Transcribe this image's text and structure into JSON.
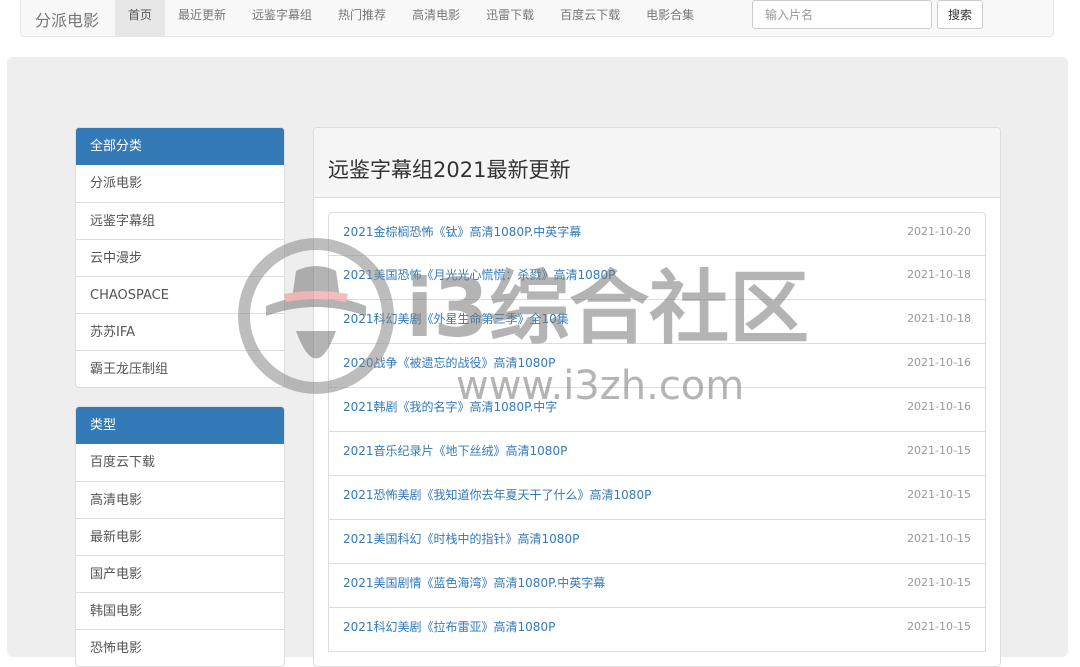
{
  "brand": "分派电影",
  "nav": [
    {
      "label": "首页",
      "active": true
    },
    {
      "label": "最近更新"
    },
    {
      "label": "远鉴字幕组"
    },
    {
      "label": "热门推荐"
    },
    {
      "label": "高清电影"
    },
    {
      "label": "迅雷下载"
    },
    {
      "label": "百度云下载"
    },
    {
      "label": "电影合集"
    }
  ],
  "search": {
    "placeholder": "输入片名",
    "button": "搜索"
  },
  "categories": {
    "heading": "全部分类",
    "items": [
      "分派电影",
      "远鉴字幕组",
      "云中漫步",
      "CHAOSPACE",
      "苏苏IFA",
      "霸王龙压制组"
    ]
  },
  "types": {
    "heading": "类型",
    "items": [
      "百度云下载",
      "高清电影",
      "最新电影",
      "国产电影",
      "韩国电影",
      "恐怖电影"
    ]
  },
  "main": {
    "title": "远鉴字幕组2021最新更新",
    "items": [
      {
        "title": "2021金棕榈恐怖《钛》高清1080P.中英字幕",
        "date": "2021-10-20"
      },
      {
        "title": "2021美国恐怖《月光光心慌慌：杀戮》高清1080P",
        "date": "2021-10-18"
      },
      {
        "title": "2021科幻美剧《外星生命第三季》全10集",
        "date": "2021-10-18"
      },
      {
        "title": "2020战争《被遗忘的战役》高清1080P",
        "date": "2021-10-16"
      },
      {
        "title": "2021韩剧《我的名字》高清1080P.中字",
        "date": "2021-10-16"
      },
      {
        "title": "2021音乐纪录片《地下丝绒》高清1080P",
        "date": "2021-10-15"
      },
      {
        "title": "2021恐怖美剧《我知道你去年夏天干了什么》高清1080P",
        "date": "2021-10-15"
      },
      {
        "title": "2021美国科幻《时栈中的指针》高清1080P",
        "date": "2021-10-15"
      },
      {
        "title": "2021美国剧情《蓝色海湾》高清1080P.中英字幕",
        "date": "2021-10-15"
      },
      {
        "title": "2021科幻美剧《拉布雷亚》高清1080P",
        "date": "2021-10-15"
      }
    ]
  },
  "watermark": {
    "line1": "i3综合社区",
    "line2": "www.i3zh.com"
  },
  "colors": {
    "primary": "#337ab7",
    "link": "#337ab7",
    "jumbotron": "#eeeeee"
  }
}
